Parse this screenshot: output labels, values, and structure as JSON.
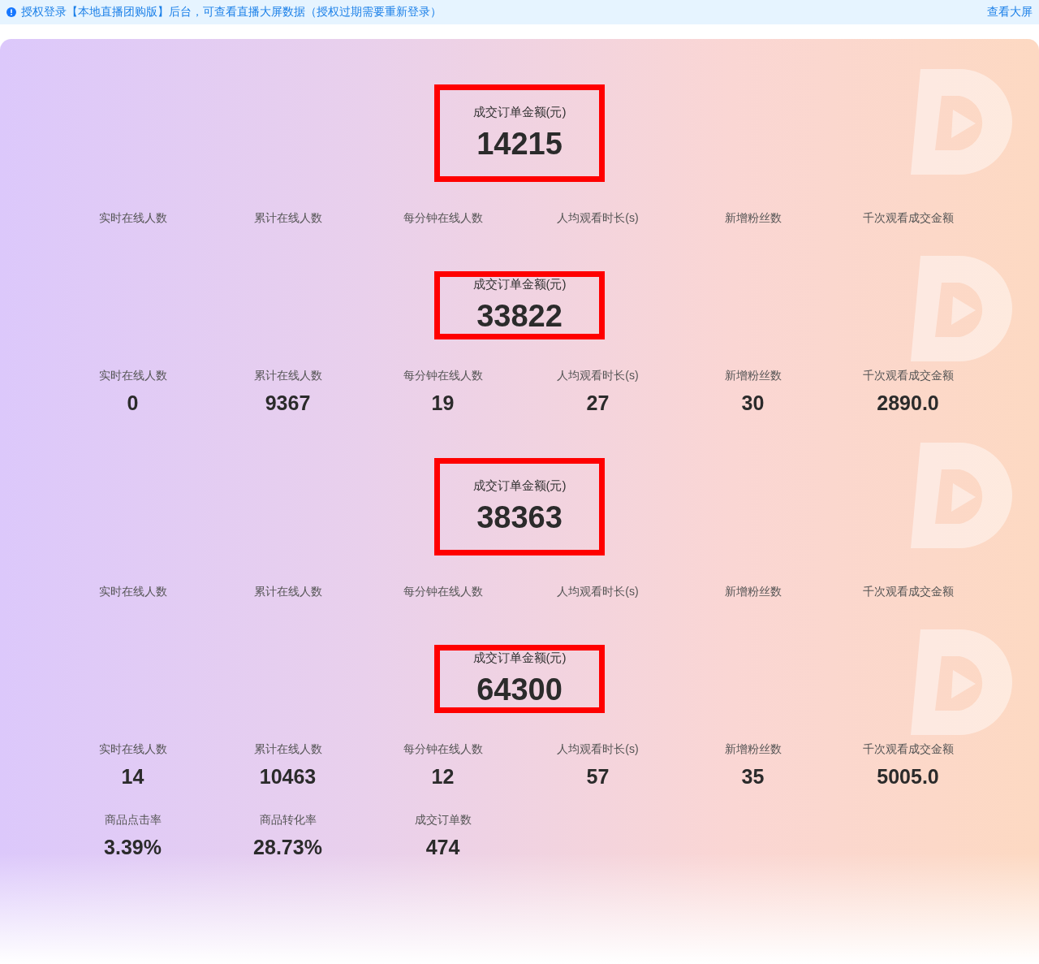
{
  "notice": {
    "text": "授权登录【本地直播团购版】后台，可查看直播大屏数据（授权过期需要重新登录）",
    "link": "查看大屏"
  },
  "sections": [
    {
      "amount_label": "成交订单金额(元)",
      "amount": "14215",
      "stats": [
        {
          "label": "实时在线人数"
        },
        {
          "label": "累计在线人数"
        },
        {
          "label": "每分钟在线人数"
        },
        {
          "label": "人均观看时长(s)"
        },
        {
          "label": "新增粉丝数"
        },
        {
          "label": "千次观看成交金额"
        }
      ]
    },
    {
      "amount_label": "成交订单金额(元)",
      "amount": "33822",
      "stats": [
        {
          "label": "实时在线人数",
          "value": "0"
        },
        {
          "label": "累计在线人数",
          "value": "9367"
        },
        {
          "label": "每分钟在线人数",
          "value": "19"
        },
        {
          "label": "人均观看时长(s)",
          "value": "27"
        },
        {
          "label": "新增粉丝数",
          "value": "30"
        },
        {
          "label": "千次观看成交金额",
          "value": "2890.0"
        }
      ]
    },
    {
      "amount_label": "成交订单金额(元)",
      "amount": "38363",
      "stats": [
        {
          "label": "实时在线人数"
        },
        {
          "label": "累计在线人数"
        },
        {
          "label": "每分钟在线人数"
        },
        {
          "label": "人均观看时长(s)"
        },
        {
          "label": "新增粉丝数"
        },
        {
          "label": "千次观看成交金额"
        }
      ]
    },
    {
      "amount_label": "成交订单金额(元)",
      "amount": "64300",
      "stats": [
        {
          "label": "实时在线人数",
          "value": "14"
        },
        {
          "label": "累计在线人数",
          "value": "10463"
        },
        {
          "label": "每分钟在线人数",
          "value": "12"
        },
        {
          "label": "人均观看时长(s)",
          "value": "57"
        },
        {
          "label": "新增粉丝数",
          "value": "35"
        },
        {
          "label": "千次观看成交金额",
          "value": "5005.0"
        }
      ]
    }
  ],
  "extra_stats": [
    {
      "label": "商品点击率",
      "value": "3.39%"
    },
    {
      "label": "商品转化率",
      "value": "28.73%"
    },
    {
      "label": "成交订单数",
      "value": "474"
    }
  ]
}
